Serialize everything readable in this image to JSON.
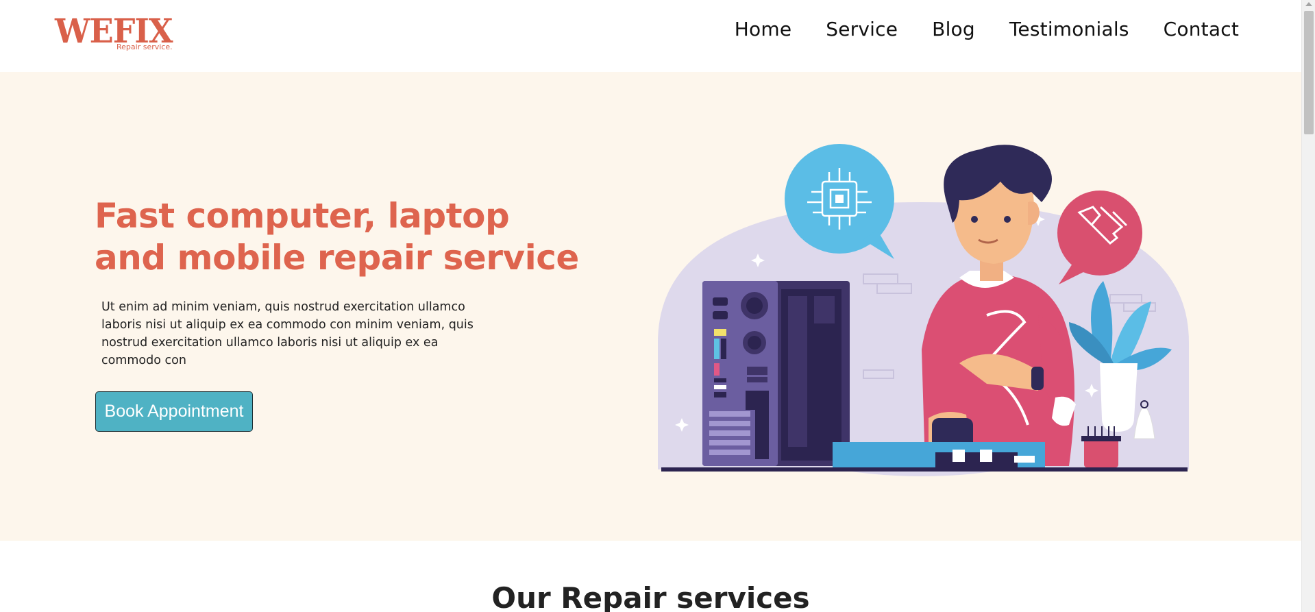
{
  "logo": {
    "mark": "WEFIX",
    "tagline": "Repair service."
  },
  "nav": {
    "items": [
      {
        "label": "Home"
      },
      {
        "label": "Service"
      },
      {
        "label": "Blog"
      },
      {
        "label": "Testimonials"
      },
      {
        "label": "Contact"
      }
    ]
  },
  "hero": {
    "title_line1": "Fast computer, laptop",
    "title_line2": "and mobile repair service",
    "body": "Ut enim ad minim veniam, quis nostrud exercitation ullamco laboris nisi ut aliquip ex ea commodo con minim veniam, quis nostrud exercitation ullamco laboris nisi ut aliquip ex ea commodo con",
    "cta_label": "Book Appointment"
  },
  "services": {
    "heading": "Our Repair services"
  },
  "colors": {
    "brand": "#de644e",
    "hero_bg": "#fdf6ec",
    "button": "#4fb2c4",
    "text": "#222222"
  },
  "icons": [
    "chip-bubble-icon",
    "wrench-bubble-icon",
    "scroll-up-arrow-icon"
  ]
}
